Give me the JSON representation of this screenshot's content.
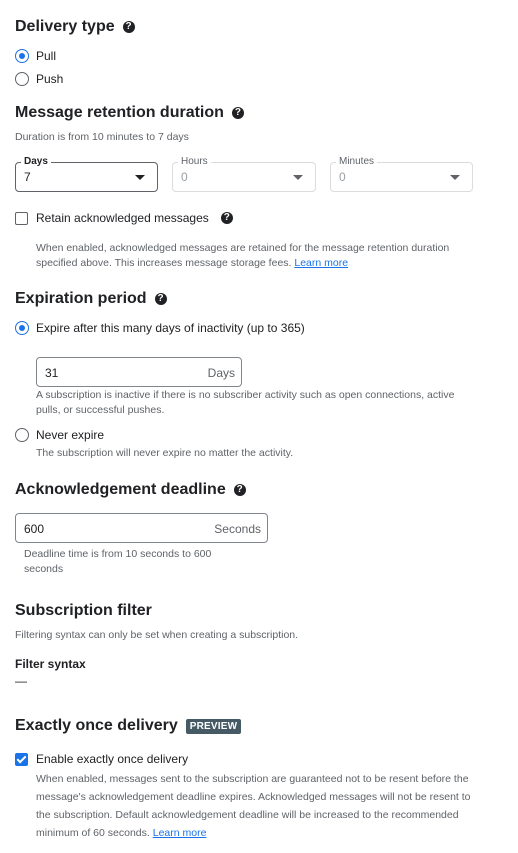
{
  "delivery_type": {
    "title": "Delivery type",
    "help_icon": "help-icon",
    "options": [
      {
        "label": "Pull",
        "selected": true
      },
      {
        "label": "Push",
        "selected": false
      }
    ]
  },
  "retention": {
    "title": "Message retention duration",
    "hint": "Duration is from 10 minutes to 7 days",
    "days": {
      "label": "Days",
      "value": "7"
    },
    "hours": {
      "label": "Hours",
      "value": "0"
    },
    "minutes": {
      "label": "Minutes",
      "value": "0"
    },
    "retain_acked": {
      "label": "Retain acknowledged messages",
      "checked": false
    },
    "retain_hint": "When enabled, acknowledged messages are retained for the message retention duration specified above. This increases message storage fees.",
    "learn_more": "Learn more"
  },
  "expiration": {
    "title": "Expiration period",
    "expire_option": {
      "label": "Expire after this many days of inactivity (up to 365)",
      "selected": true
    },
    "days_value": "31",
    "days_suffix": "Days",
    "expire_hint": "A subscription is inactive if there is no subscriber activity such as open connections, active pulls, or successful pushes.",
    "never_option": {
      "label": "Never expire",
      "selected": false
    },
    "never_hint": "The subscription will never expire no matter the activity."
  },
  "ack_deadline": {
    "title": "Acknowledgement deadline",
    "value": "600",
    "suffix": "Seconds",
    "hint": "Deadline time is from 10 seconds to 600 seconds"
  },
  "filter": {
    "title": "Subscription filter",
    "hint": "Filtering syntax can only be set when creating a subscription.",
    "syntax_label": "Filter syntax",
    "syntax_value": "—"
  },
  "exactly_once": {
    "title": "Exactly once delivery",
    "badge": "PREVIEW",
    "checkbox": {
      "label": "Enable exactly once delivery",
      "checked": true
    },
    "hint": "When enabled, messages sent to the subscription are guaranteed not to be resent before the message's acknowledgement deadline expires. Acknowledged messages will not be resent to the subscription. Default acknowledgement deadline will be increased to the recommended minimum of 60 seconds.",
    "learn_more": "Learn more"
  },
  "colors": {
    "accent": "#1a73e8",
    "text": "#202124",
    "secondary": "#5f6368",
    "badge": "#455a64"
  }
}
